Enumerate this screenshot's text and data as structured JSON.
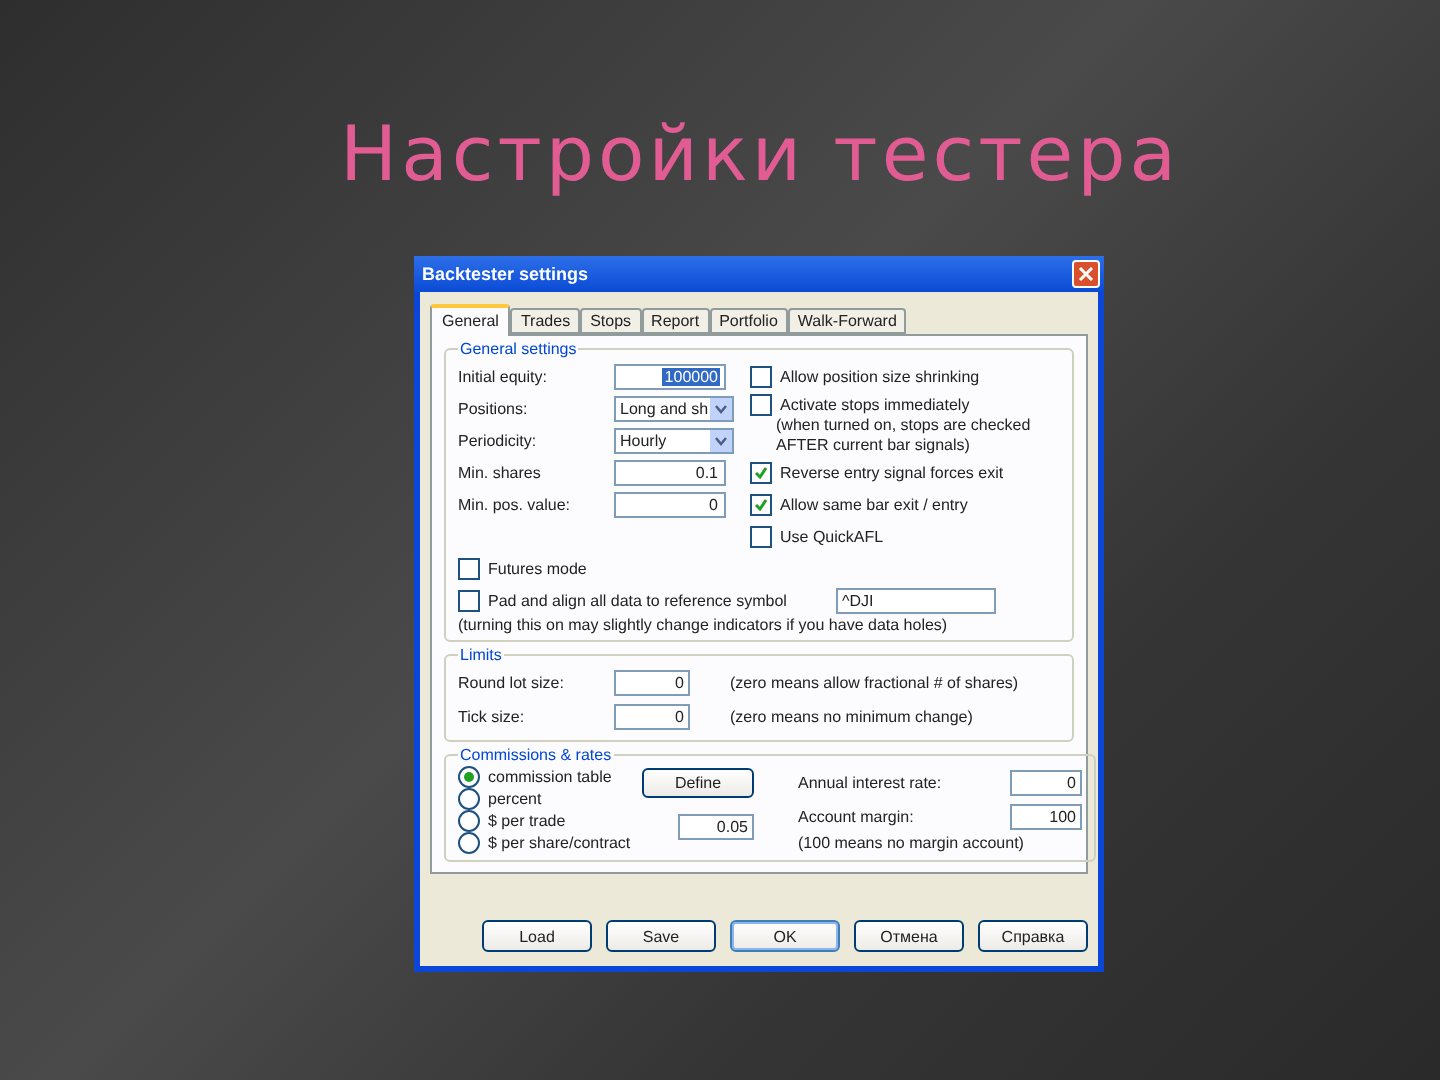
{
  "slide_title": "Настройки тестера",
  "dialog": {
    "title": "Backtester settings",
    "tabs": [
      {
        "label": "General",
        "selected": true
      },
      {
        "label": "Trades",
        "selected": false
      },
      {
        "label": "Stops",
        "selected": false
      },
      {
        "label": "Report",
        "selected": false
      },
      {
        "label": "Portfolio",
        "selected": false
      },
      {
        "label": "Walk-Forward",
        "selected": false
      }
    ],
    "general": {
      "legend": "General settings",
      "fields": [
        {
          "label": "Initial equity:",
          "value": "100000",
          "kind": "text",
          "highlighted": true
        },
        {
          "label": "Positions:",
          "value": "Long and sh",
          "kind": "select"
        },
        {
          "label": "Periodicity:",
          "value": "Hourly",
          "kind": "select"
        },
        {
          "label": "Min. shares",
          "value": "0.1",
          "kind": "text",
          "highlighted": false
        },
        {
          "label": "Min. pos. value:",
          "value": "0",
          "kind": "text",
          "highlighted": false
        }
      ],
      "options": [
        {
          "label": "Allow position size shrinking",
          "checked": false
        },
        {
          "label": "Activate stops immediately",
          "checked": false,
          "note": "(when turned on, stops are checked AFTER current bar signals)"
        },
        {
          "label": "Reverse entry signal forces exit",
          "checked": true
        },
        {
          "label": "Allow same bar exit / entry",
          "checked": true
        },
        {
          "label": "Use QuickAFL",
          "checked": false
        }
      ],
      "futures": {
        "label": "Futures mode",
        "checked": false
      },
      "pad": {
        "label": "Pad and align all data to reference symbol",
        "checked": false,
        "value": "^DJI"
      },
      "pad_note": "(turning this on may slightly change indicators if you have data holes)"
    },
    "limits": {
      "legend": "Limits",
      "rows": [
        {
          "label": "Round lot size:",
          "value": "0",
          "note": "(zero means allow fractional # of shares)"
        },
        {
          "label": "Tick size:",
          "value": "0",
          "note": "(zero means no minimum change)"
        }
      ]
    },
    "commissions": {
      "legend": "Commissions & rates",
      "modes": [
        {
          "label": "commission table",
          "selected": true
        },
        {
          "label": "percent",
          "selected": false
        },
        {
          "label": "$ per trade",
          "selected": false
        },
        {
          "label": "$ per share/contract",
          "selected": false
        }
      ],
      "define_button": "Define",
      "amount": "0.05",
      "rates": [
        {
          "label": "Annual interest rate:",
          "value": "0"
        },
        {
          "label": "Account margin:",
          "value": "100"
        }
      ],
      "rates_note": "(100 means no margin account)"
    },
    "buttons": [
      {
        "label": "Load",
        "default": false
      },
      {
        "label": "Save",
        "default": false
      },
      {
        "label": "OK",
        "default": true
      },
      {
        "label": "Отмена",
        "default": false
      },
      {
        "label": "Справка",
        "default": false
      }
    ]
  }
}
